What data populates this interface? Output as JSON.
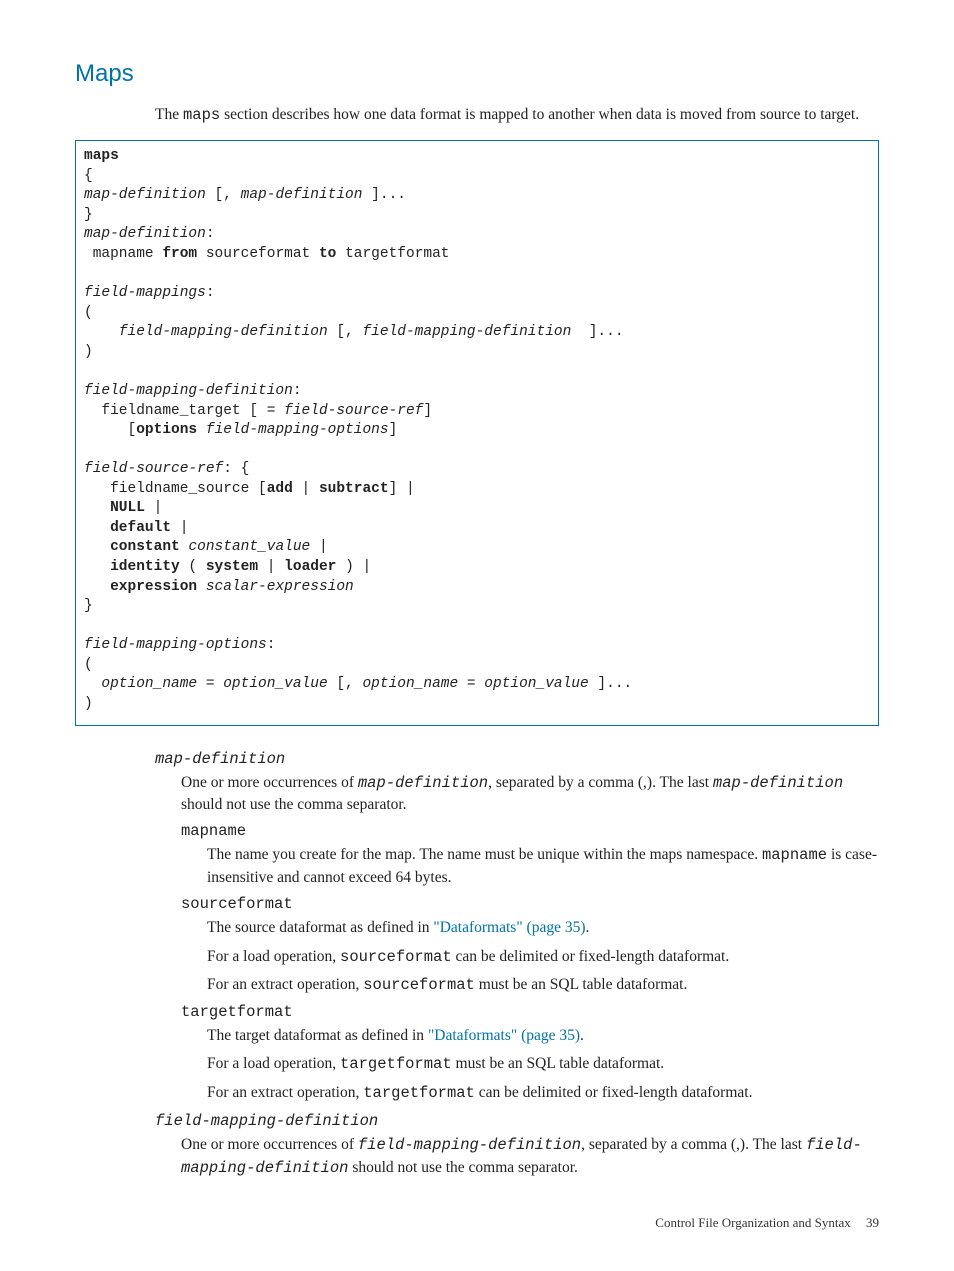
{
  "section_heading": "Maps",
  "intro": {
    "pre": "The ",
    "code": "maps",
    "post": " section describes how one data format is mapped to another when data is moved from source to target."
  },
  "code": {
    "l1_b": "maps",
    "l2": "{",
    "l3a": "map-definition",
    "l3b": " [, ",
    "l3c": "map-definition",
    "l3d": " ]...",
    "l4": "}",
    "l5a": "map-definition",
    "l5b": ":",
    "l6a": " mapname ",
    "l6b": "from",
    "l6c": " sourceformat ",
    "l6d": "to",
    "l6e": " targetformat",
    "blank1": "",
    "l7a": "field-mappings",
    "l7b": ":",
    "l8": "(",
    "l9a": "    ",
    "l9b": "field-mapping-definition",
    "l9c": " [, ",
    "l9d": "field-mapping-definition",
    "l9e": "  ]...",
    "l10": ")",
    "blank2": "",
    "l11a": "field-mapping-definition",
    "l11b": ":",
    "l12a": "  fieldname_target [ = ",
    "l12b": "field-source-ref",
    "l12c": "]",
    "l13a": "     [",
    "l13b": "options",
    "l13c": " ",
    "l13d": "field-mapping-options",
    "l13e": "]",
    "blank3": "",
    "l14a": "field-source-ref",
    "l14b": ": {",
    "l15a": "   fieldname_source [",
    "l15b": "add",
    "l15c": " | ",
    "l15d": "subtract",
    "l15e": "] |",
    "l16a": "   ",
    "l16b": "NULL",
    "l16c": " |",
    "l17a": "   ",
    "l17b": "default",
    "l17c": " |",
    "l18a": "   ",
    "l18b": "constant",
    "l18c": " ",
    "l18d": "constant_value",
    "l18e": " |",
    "l19a": "   ",
    "l19b": "identity",
    "l19c": " ( ",
    "l19d": "system",
    "l19e": " | ",
    "l19f": "loader",
    "l19g": " ) |",
    "l20a": "   ",
    "l20b": "expression",
    "l20c": " ",
    "l20d": "scalar-expression",
    "l21": "}",
    "blank4": "",
    "l22a": "field-mapping-options",
    "l22b": ":",
    "l23": "(",
    "l24a": "  ",
    "l24b": "option_name = option_value",
    "l24c": " [, ",
    "l24d": "option_name = option_value",
    "l24e": " ]...",
    "l25": ")"
  },
  "defs": {
    "d1_term": "map-definition",
    "d1_p1a": "One or more occurrences of ",
    "d1_p1b": "map-definition",
    "d1_p1c": ", separated by a comma (,). The last ",
    "d1_p1d": "map-definition",
    "d1_p1e": " should not use the comma separator.",
    "d1_s1_term": "mapname",
    "d1_s1_p1a": "The name you create for the map. The name must be unique within the maps namespace. ",
    "d1_s1_p1b": "mapname",
    "d1_s1_p1c": " is case-insensitive and cannot exceed 64 bytes.",
    "d1_s2_term": "sourceformat",
    "d1_s2_p1a": "The source dataformat as defined in ",
    "d1_s2_link": "\"Dataformats\" (page 35)",
    "d1_s2_p1b": ".",
    "d1_s2_p2a": "For a load operation, ",
    "d1_s2_p2b": "sourceformat",
    "d1_s2_p2c": " can be delimited or fixed-length dataformat.",
    "d1_s2_p3a": "For an extract operation, ",
    "d1_s2_p3b": "sourceformat",
    "d1_s2_p3c": " must be an SQL table dataformat.",
    "d1_s3_term": "targetformat",
    "d1_s3_p1a": "The target dataformat as defined in ",
    "d1_s3_link": "\"Dataformats\" (page 35)",
    "d1_s3_p1b": ".",
    "d1_s3_p2a": "For a load operation, ",
    "d1_s3_p2b": "targetformat",
    "d1_s3_p2c": " must be an SQL table dataformat.",
    "d1_s3_p3a": "For an extract operation, ",
    "d1_s3_p3b": "targetformat",
    "d1_s3_p3c": " can be delimited or fixed-length dataformat.",
    "d2_term": "field-mapping-definition",
    "d2_p1a": "One or more occurrences of ",
    "d2_p1b": "field-mapping-definition",
    "d2_p1c": ", separated by a comma (,). The last ",
    "d2_p1d": "field-mapping-definition",
    "d2_p1e": " should not use the comma separator."
  },
  "footer": {
    "text": "Control File Organization and Syntax",
    "page": "39"
  }
}
